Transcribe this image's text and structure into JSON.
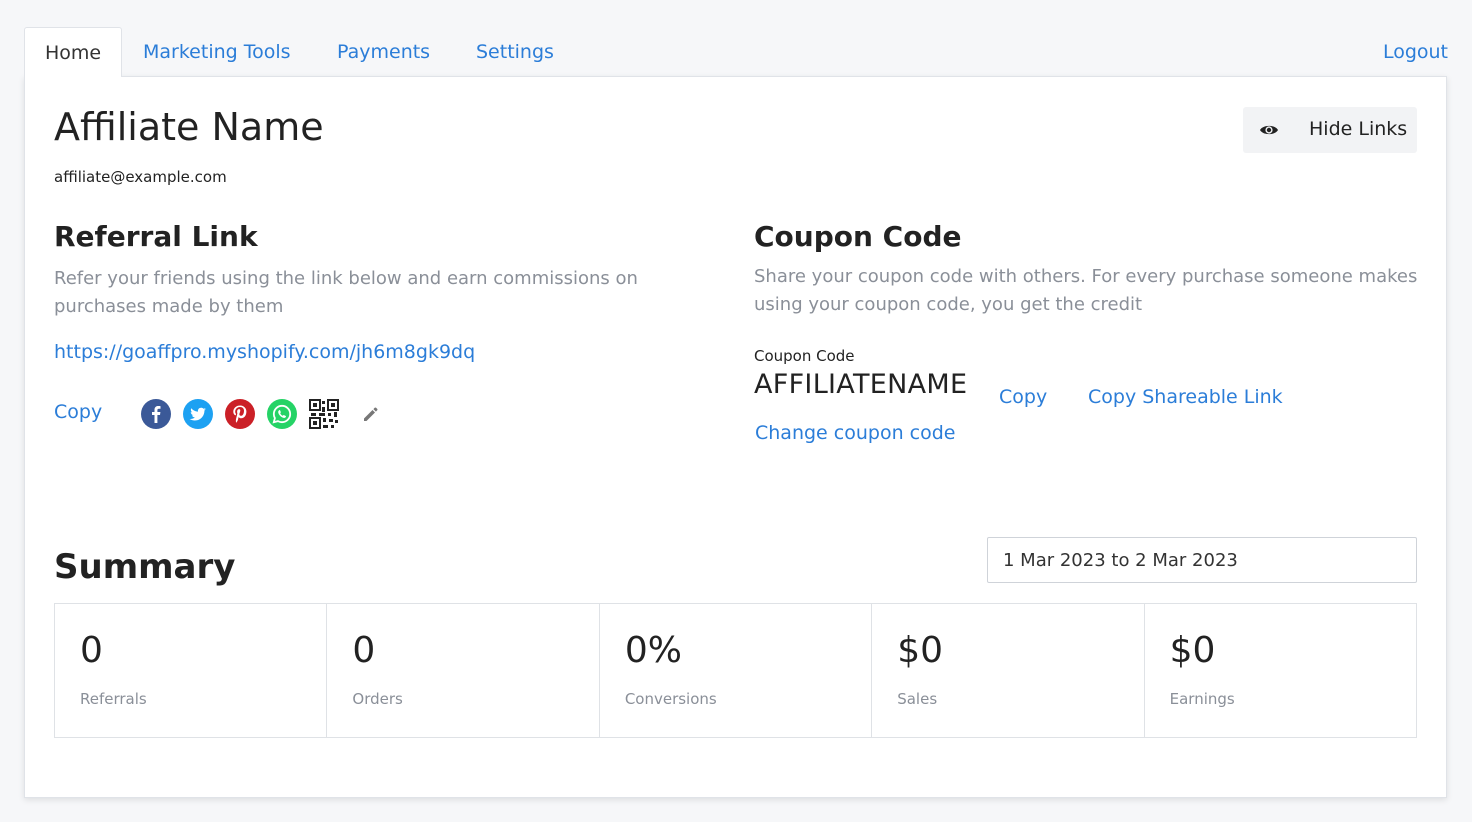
{
  "tabs": [
    {
      "label": "Home",
      "active": true
    },
    {
      "label": "Marketing Tools",
      "active": false
    },
    {
      "label": "Payments",
      "active": false
    },
    {
      "label": "Settings",
      "active": false
    }
  ],
  "logout_label": "Logout",
  "affiliate": {
    "name": "Affiliate Name",
    "email": "affiliate@example.com"
  },
  "hide_links": {
    "label": "Hide Links",
    "icon": "eye-icon"
  },
  "referral": {
    "title": "Referral Link",
    "description": "Refer your friends using the link below and earn commissions on purchases made by them",
    "link": "https://goaffpro.myshopify.com/jh6m8gk9dq",
    "copy_label": "Copy",
    "share_icons": [
      "facebook-icon",
      "twitter-icon",
      "pinterest-icon",
      "whatsapp-icon",
      "qr-code-icon",
      "pencil-icon"
    ]
  },
  "coupon": {
    "title": "Coupon Code",
    "description": "Share your coupon code with others. For every purchase someone makes using your coupon code, you get the credit",
    "label": "Coupon Code",
    "code": "AFFILIATENAME",
    "copy_label": "Copy",
    "share_label": "Copy Shareable Link",
    "change_label": "Change coupon code"
  },
  "summary": {
    "title": "Summary",
    "date_range": "1 Mar 2023 to 2 Mar 2023",
    "stats": [
      {
        "value": "0",
        "label": "Referrals"
      },
      {
        "value": "0",
        "label": "Orders"
      },
      {
        "value": "0%",
        "label": "Conversions"
      },
      {
        "value": "$0",
        "label": "Sales"
      },
      {
        "value": "$0",
        "label": "Earnings"
      }
    ]
  },
  "colors": {
    "link": "#2b7dd8",
    "facebook": "#3b5998",
    "twitter": "#1da1f2",
    "pinterest": "#cb2027",
    "whatsapp": "#25d366"
  }
}
